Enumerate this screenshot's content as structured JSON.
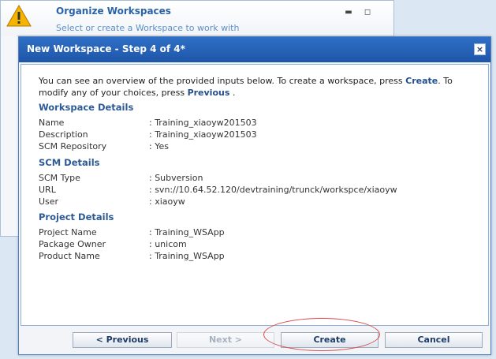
{
  "background_window": {
    "title": "Organize Workspaces",
    "subtitle": "Select or create a Workspace to work with",
    "minimize_label": "▬",
    "restore_label": "◻"
  },
  "dialog": {
    "title": "New Workspace - Step 4 of 4*",
    "close_label": "×",
    "intro_part1": "You can see an overview of the provided inputs below. To create a workspace, press ",
    "intro_create": "Create",
    "intro_part2": ". To modify any of your choices, press ",
    "intro_previous": "Previous",
    "intro_part3": " .",
    "sections": {
      "workspace": {
        "title": "Workspace Details",
        "rows": [
          {
            "label": "Name",
            "value": ": Training_xiaoyw201503"
          },
          {
            "label": "Description",
            "value": ": Training_xiaoyw201503"
          },
          {
            "label": "SCM Repository",
            "value": ": Yes"
          }
        ]
      },
      "scm": {
        "title": "SCM Details",
        "rows": [
          {
            "label": "SCM Type",
            "value": ": Subversion"
          },
          {
            "label": "URL",
            "value": ": svn://10.64.52.120/devtraining/trunck/workspce/xiaoyw"
          },
          {
            "label": "User",
            "value": ": xiaoyw"
          }
        ]
      },
      "project": {
        "title": "Project Details",
        "rows": [
          {
            "label": "Project Name",
            "value": ": Training_WSApp"
          },
          {
            "label": "Package Owner",
            "value": ": unicom"
          },
          {
            "label": "Product Name",
            "value": ": Training_WSApp"
          }
        ]
      }
    },
    "buttons": {
      "previous": "< Previous",
      "next": "Next >",
      "create": "Create",
      "cancel": "Cancel"
    }
  },
  "colors": {
    "titlebar": "#1e56a8",
    "accent_text": "#2d5a94",
    "highlight": "#d94b4b"
  }
}
